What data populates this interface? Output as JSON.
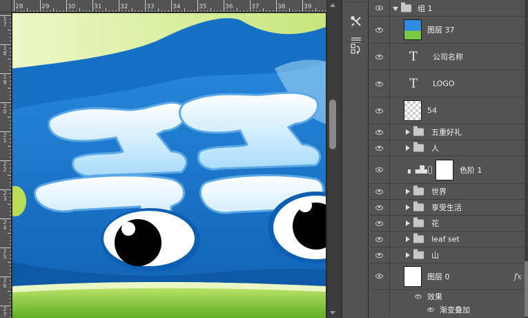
{
  "ruler": {
    "top_labels": [
      "28",
      "29",
      "30",
      "31",
      "32",
      "33",
      "34",
      "35",
      "36",
      "37",
      "38",
      "39"
    ],
    "left_labels": [
      "17",
      "18",
      "19",
      "20",
      "21",
      "22",
      "23",
      "24",
      "25",
      "26",
      "27"
    ]
  },
  "dock": {
    "icons": [
      "tools-icon",
      "brush-settings-icon",
      "history-icon"
    ]
  },
  "layers": {
    "group": {
      "name": "组 1",
      "expanded": true
    },
    "rows": [
      {
        "type": "image",
        "name": "图层 37"
      },
      {
        "type": "text",
        "name": "公司名称"
      },
      {
        "type": "text",
        "name": "LOGO"
      },
      {
        "type": "transparent",
        "name": "54"
      },
      {
        "type": "folder",
        "name": "五重好礼"
      },
      {
        "type": "folder",
        "name": "人"
      },
      {
        "type": "adjustment",
        "name": "色阶 1"
      },
      {
        "type": "folder",
        "name": "世界"
      },
      {
        "type": "folder",
        "name": "享受生活"
      },
      {
        "type": "folder",
        "name": "花"
      },
      {
        "type": "folder",
        "name": "leaf set"
      },
      {
        "type": "folder",
        "name": "山"
      },
      {
        "type": "image-white",
        "name": "图层 0",
        "fx": "fx"
      }
    ],
    "effects_label": "效果",
    "effect_items": [
      "渐变叠加"
    ]
  },
  "colors": {
    "panel_bg": "#535353",
    "row_border": "#3d3d3d",
    "canvas_blue": "#1e7fd0",
    "grass_green": "#7ac943"
  }
}
